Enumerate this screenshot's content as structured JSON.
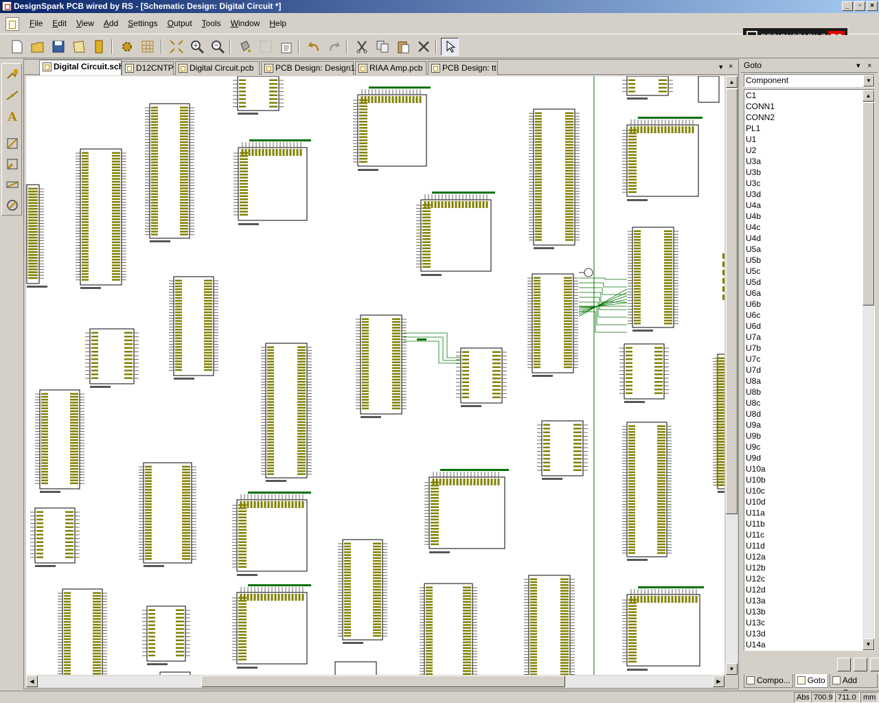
{
  "window": {
    "title": "DesignSpark PCB wired by RS - [Schematic Design: Digital Circuit *]",
    "minimize_label": "_",
    "restore_label": "▫",
    "close_label": "×"
  },
  "menu": {
    "items": [
      {
        "pre": "",
        "u": "F",
        "rest": "ile"
      },
      {
        "pre": "",
        "u": "E",
        "rest": "dit"
      },
      {
        "pre": "",
        "u": "V",
        "rest": "iew"
      },
      {
        "pre": "",
        "u": "A",
        "rest": "dd"
      },
      {
        "pre": "",
        "u": "S",
        "rest": "ettings"
      },
      {
        "pre": "",
        "u": "O",
        "rest": "utput"
      },
      {
        "pre": "",
        "u": "T",
        "rest": "ools"
      },
      {
        "pre": "",
        "u": "W",
        "rest": "indow"
      },
      {
        "pre": "",
        "u": "H",
        "rest": "elp"
      }
    ],
    "mdi_minimize": "_",
    "mdi_restore": "▫",
    "mdi_close": "×"
  },
  "brand": {
    "text": "DESIGNSPARK PCB",
    "rs": "RS"
  },
  "toolbar": {
    "icons": [
      "new-file-icon",
      "open-folder-icon",
      "save-icon",
      "open-library-icon",
      "library-books-icon",
      "design-settings-icon",
      "grid-icon",
      "fit-view-icon",
      "zoom-in-icon",
      "zoom-out-icon",
      "paint-bucket-icon",
      "dotted-grid-icon",
      "properties-icon",
      "undo-icon",
      "redo-icon",
      "cut-icon",
      "copy-icon",
      "paste-icon",
      "delete-icon",
      "select-pointer-icon"
    ]
  },
  "tabs": [
    {
      "label": "Digital Circuit.sch",
      "active": true
    },
    {
      "label": "D12CNTP",
      "active": false
    },
    {
      "label": "Digital Circuit.pcb",
      "active": false
    },
    {
      "label": "PCB Design: Design1",
      "active": false
    },
    {
      "label": "RIAA Amp.pcb",
      "active": false
    },
    {
      "label": "PCB Design: tt",
      "active": false
    }
  ],
  "tab_controls": {
    "dropdown": "▾",
    "close": "×"
  },
  "goto_panel": {
    "title": "Goto",
    "pin_label": "▾",
    "close_label": "×",
    "filter_value": "Component",
    "items": [
      "C1",
      "CONN1",
      "CONN2",
      "PL1",
      "U1",
      "U2",
      "U3a",
      "U3b",
      "U3c",
      "U3d",
      "U4a",
      "U4b",
      "U4c",
      "U4d",
      "U5a",
      "U5b",
      "U5c",
      "U5d",
      "U6a",
      "U6b",
      "U6c",
      "U6d",
      "U7a",
      "U7b",
      "U7c",
      "U7d",
      "U8a",
      "U8b",
      "U8c",
      "U8d",
      "U9a",
      "U9b",
      "U9c",
      "U9d",
      "U10a",
      "U10b",
      "U10c",
      "U10d",
      "U11a",
      "U11b",
      "U11c",
      "U11d",
      "U12a",
      "U12b",
      "U12c",
      "U12d",
      "U13a",
      "U13b",
      "U13c",
      "U13d",
      "U14a"
    ],
    "bottom_tabs": [
      {
        "label": "Compo...",
        "active": false
      },
      {
        "label": "Goto",
        "active": true
      },
      {
        "label": "Add Co...",
        "active": false
      }
    ]
  },
  "status": {
    "mode": "Abs",
    "x": "700.9",
    "y": "711.0",
    "units": "mm"
  },
  "colors": {
    "component_outline": "#000000",
    "pin_label": "#808000",
    "net_wire": "#007000"
  }
}
